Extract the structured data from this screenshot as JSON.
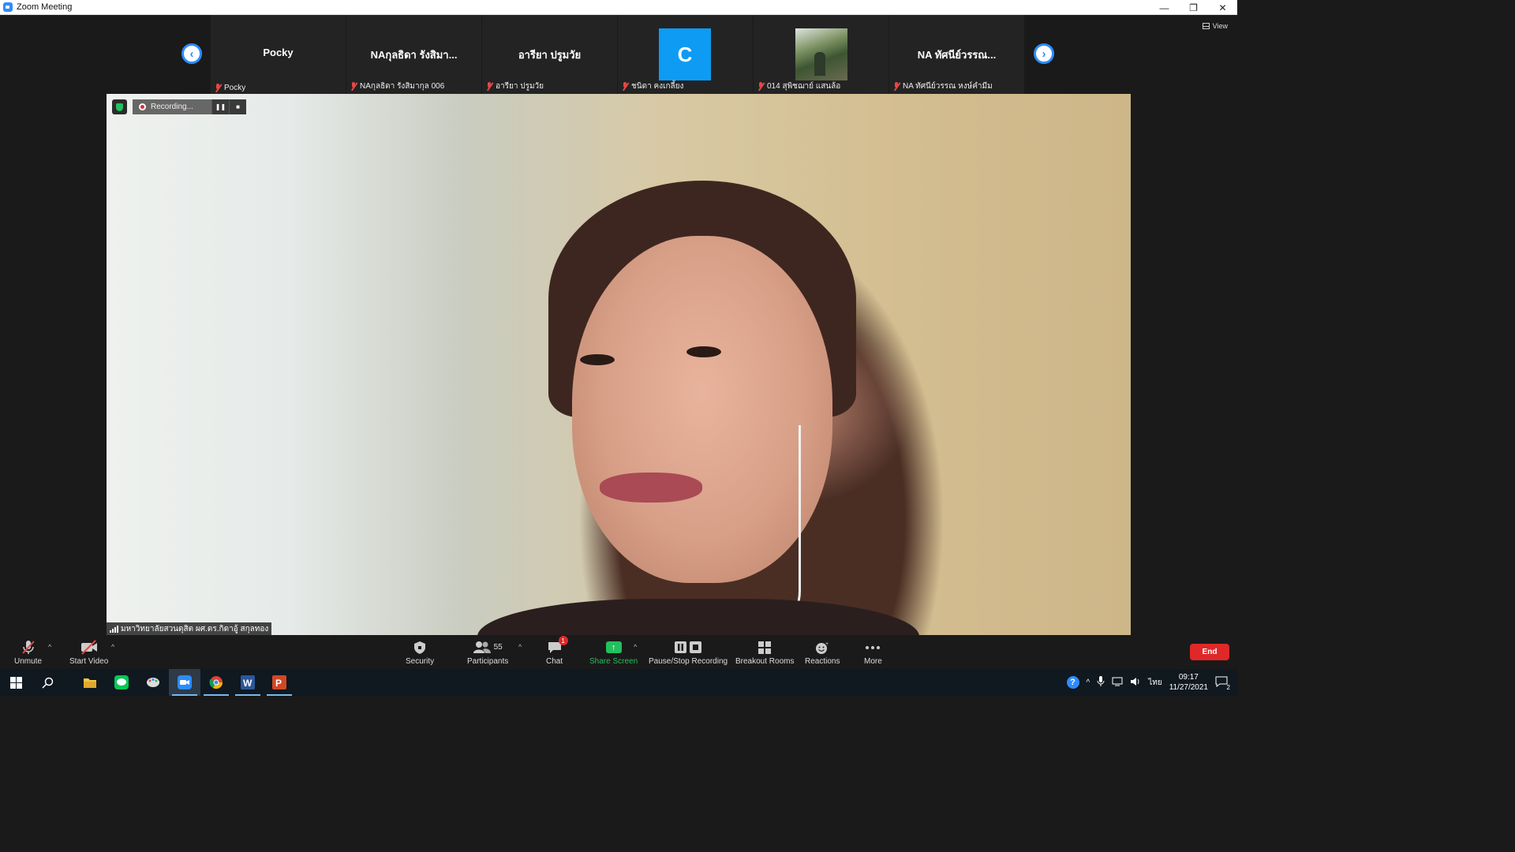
{
  "window": {
    "title": "Zoom Meeting",
    "controls": [
      "—",
      "❐",
      "✕"
    ]
  },
  "view": {
    "label": "View"
  },
  "participants_strip": [
    {
      "name_display": "Pocky",
      "label": "Pocky",
      "tile_type": "name"
    },
    {
      "name_display": "NAกุลธิดา รังสิมา...",
      "label": "NAกุลธิดา รังสิมากุล 006",
      "tile_type": "name"
    },
    {
      "name_display": "อารียา ปรูมวัย",
      "label": "อารียา ปรูมวัย",
      "tile_type": "name"
    },
    {
      "name_display": "C",
      "label": "ชนิดา คงเกลี้ยง",
      "tile_type": "avatar",
      "avatar_color": "#0e9bf4"
    },
    {
      "name_display": "",
      "label": "014 สุพิชฌาย์ แสนล้อ",
      "tile_type": "photo"
    },
    {
      "name_display": "NA ทัศนีย์วรรณ...",
      "label": "NA ทัศนีย์วรรณ หงษ์คำมีม",
      "tile_type": "name"
    }
  ],
  "recording": {
    "label": "Recording...",
    "pause_symbol": "❚❚",
    "stop_symbol": "■"
  },
  "active_speaker": {
    "label": "มหาวิทยาลัยสวนดุสิต ผศ.ดร.กิดาอู้ สกุลทอง"
  },
  "toolbar": {
    "unmute": "Unmute",
    "start_video": "Start Video",
    "security": "Security",
    "participants": "Participants",
    "participants_count": "55",
    "chat": "Chat",
    "chat_badge": "1",
    "share_screen": "Share Screen",
    "pause_stop_recording": "Pause/Stop Recording",
    "breakout_rooms": "Breakout Rooms",
    "reactions": "Reactions",
    "more": "More",
    "end": "End"
  },
  "colors": {
    "accent": "#2d8cff",
    "share_green": "#23c05e",
    "end_red": "#e02828",
    "muted_red": "#e24848"
  },
  "taskbar": {
    "apps": [
      "start-icon",
      "search-icon",
      "file-explorer-icon",
      "line-icon",
      "paint-icon",
      "zoom-icon",
      "chrome-icon",
      "word-icon",
      "powerpoint-icon"
    ],
    "tray": {
      "language": "ไทย",
      "time": "09:17",
      "date": "11/27/2021",
      "notifications": "2"
    }
  }
}
